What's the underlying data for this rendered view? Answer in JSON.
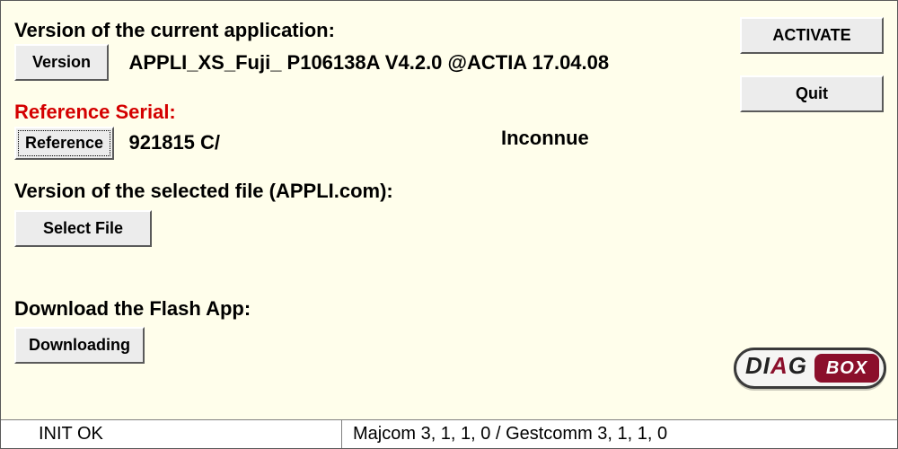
{
  "sections": {
    "version_app": {
      "label": "Version of the current application:",
      "button": "Version",
      "value": "APPLI_XS_Fuji_ P106138A  V4.2.0 @ACTIA 17.04.08"
    },
    "reference": {
      "label": "Reference Serial:",
      "button": "Reference",
      "value": "921815  C/",
      "status": "Inconnue"
    },
    "selected_file": {
      "label": "Version of the selected file (APPLI.com):",
      "button": "Select File"
    },
    "download": {
      "label": "Download the Flash App:",
      "button": "Downloading"
    }
  },
  "right_buttons": {
    "activate": "ACTIVATE",
    "quit": "Quit"
  },
  "statusbar": {
    "left": "INIT OK",
    "right": "Majcom 3, 1, 1, 0 / Gestcomm 3, 1, 1, 0"
  },
  "logo": {
    "part1": "DI",
    "part1_accent": "A",
    "part1_end": "G",
    "part2": "BOX"
  }
}
